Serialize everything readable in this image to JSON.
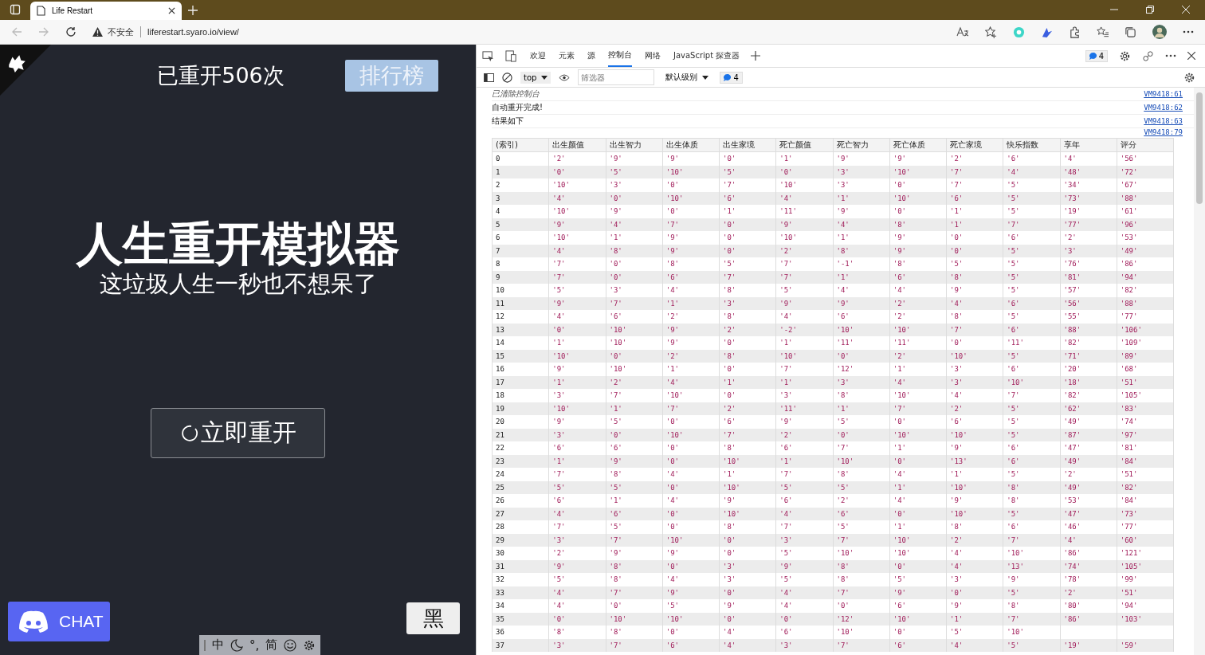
{
  "browser": {
    "tab_title": "Life Restart",
    "security": "不安全",
    "url": "liferestart.syaro.io/view/"
  },
  "page": {
    "restart_count": "已重开506次",
    "ranking_button": "排行榜",
    "title": "人生重开模拟器",
    "subtitle": "这垃圾人生一秒也不想呆了",
    "restart_button": "立即重开",
    "chat_button": "CHAT",
    "theme_button": "黑"
  },
  "ime_bar": [
    "中",
    "°,",
    "简"
  ],
  "devtools": {
    "tabs": [
      {
        "label": "欢迎",
        "selected": false
      },
      {
        "label": "元素",
        "selected": false
      },
      {
        "label": "源",
        "selected": false
      },
      {
        "label": "控制台",
        "selected": true
      },
      {
        "label": "网络",
        "selected": false
      },
      {
        "label": "JavaScript 探查器",
        "selected": false
      }
    ],
    "issues_count": "4",
    "context": "top",
    "filter_placeholder": "筛选器",
    "level": "默认级别",
    "message_count": "4",
    "messages": [
      {
        "text": "已清除控制台",
        "kind": "info",
        "source": "VM9418:61"
      },
      {
        "text": "自动重开完成!",
        "kind": "log",
        "source": "VM9418:62"
      },
      {
        "text": "结果如下",
        "kind": "log",
        "source": "VM9418:63"
      },
      {
        "kind": "table",
        "source": "VM9418:79"
      }
    ]
  },
  "table": {
    "columns": [
      "(索引)",
      "出生颜值",
      "出生智力",
      "出生体质",
      "出生家境",
      "死亡颜值",
      "死亡智力",
      "死亡体质",
      "死亡家境",
      "快乐指数",
      "享年",
      "评分"
    ],
    "rows": [
      [
        "0",
        "'2'",
        "'9'",
        "'9'",
        "'0'",
        "'1'",
        "'9'",
        "'9'",
        "'2'",
        "'6'",
        "'4'",
        "'56'"
      ],
      [
        "1",
        "'0'",
        "'5'",
        "'10'",
        "'5'",
        "'0'",
        "'3'",
        "'10'",
        "'7'",
        "'4'",
        "'48'",
        "'72'"
      ],
      [
        "2",
        "'10'",
        "'3'",
        "'0'",
        "'7'",
        "'10'",
        "'3'",
        "'0'",
        "'7'",
        "'5'",
        "'34'",
        "'67'"
      ],
      [
        "3",
        "'4'",
        "'0'",
        "'10'",
        "'6'",
        "'4'",
        "'1'",
        "'10'",
        "'6'",
        "'5'",
        "'73'",
        "'88'"
      ],
      [
        "4",
        "'10'",
        "'9'",
        "'0'",
        "'1'",
        "'11'",
        "'9'",
        "'0'",
        "'1'",
        "'5'",
        "'19'",
        "'61'"
      ],
      [
        "5",
        "'9'",
        "'4'",
        "'7'",
        "'0'",
        "'9'",
        "'4'",
        "'8'",
        "'1'",
        "'7'",
        "'77'",
        "'96'"
      ],
      [
        "6",
        "'10'",
        "'1'",
        "'9'",
        "'0'",
        "'10'",
        "'1'",
        "'9'",
        "'0'",
        "'6'",
        "'2'",
        "'53'"
      ],
      [
        "7",
        "'4'",
        "'8'",
        "'9'",
        "'0'",
        "'2'",
        "'8'",
        "'9'",
        "'0'",
        "'5'",
        "'3'",
        "'49'"
      ],
      [
        "8",
        "'7'",
        "'0'",
        "'8'",
        "'5'",
        "'7'",
        "'-1'",
        "'8'",
        "'5'",
        "'5'",
        "'76'",
        "'86'"
      ],
      [
        "9",
        "'7'",
        "'0'",
        "'6'",
        "'7'",
        "'7'",
        "'1'",
        "'6'",
        "'8'",
        "'5'",
        "'81'",
        "'94'"
      ],
      [
        "10",
        "'5'",
        "'3'",
        "'4'",
        "'8'",
        "'5'",
        "'4'",
        "'4'",
        "'9'",
        "'5'",
        "'57'",
        "'82'"
      ],
      [
        "11",
        "'9'",
        "'7'",
        "'1'",
        "'3'",
        "'9'",
        "'9'",
        "'2'",
        "'4'",
        "'6'",
        "'56'",
        "'88'"
      ],
      [
        "12",
        "'4'",
        "'6'",
        "'2'",
        "'8'",
        "'4'",
        "'6'",
        "'2'",
        "'8'",
        "'5'",
        "'55'",
        "'77'"
      ],
      [
        "13",
        "'0'",
        "'10'",
        "'9'",
        "'2'",
        "'-2'",
        "'10'",
        "'10'",
        "'7'",
        "'6'",
        "'88'",
        "'106'"
      ],
      [
        "14",
        "'1'",
        "'10'",
        "'9'",
        "'0'",
        "'1'",
        "'11'",
        "'11'",
        "'0'",
        "'11'",
        "'82'",
        "'109'"
      ],
      [
        "15",
        "'10'",
        "'0'",
        "'2'",
        "'8'",
        "'10'",
        "'0'",
        "'2'",
        "'10'",
        "'5'",
        "'71'",
        "'89'"
      ],
      [
        "16",
        "'9'",
        "'10'",
        "'1'",
        "'0'",
        "'7'",
        "'12'",
        "'1'",
        "'3'",
        "'6'",
        "'20'",
        "'68'"
      ],
      [
        "17",
        "'1'",
        "'2'",
        "'4'",
        "'1'",
        "'1'",
        "'3'",
        "'4'",
        "'3'",
        "'10'",
        "'18'",
        "'51'"
      ],
      [
        "18",
        "'3'",
        "'7'",
        "'10'",
        "'0'",
        "'3'",
        "'8'",
        "'10'",
        "'4'",
        "'7'",
        "'82'",
        "'105'"
      ],
      [
        "19",
        "'10'",
        "'1'",
        "'7'",
        "'2'",
        "'11'",
        "'1'",
        "'7'",
        "'2'",
        "'5'",
        "'62'",
        "'83'"
      ],
      [
        "20",
        "'9'",
        "'5'",
        "'0'",
        "'6'",
        "'9'",
        "'5'",
        "'0'",
        "'6'",
        "'5'",
        "'49'",
        "'74'"
      ],
      [
        "21",
        "'3'",
        "'0'",
        "'10'",
        "'7'",
        "'2'",
        "'0'",
        "'10'",
        "'10'",
        "'5'",
        "'87'",
        "'97'"
      ],
      [
        "22",
        "'6'",
        "'6'",
        "'0'",
        "'8'",
        "'6'",
        "'7'",
        "'1'",
        "'9'",
        "'6'",
        "'47'",
        "'81'"
      ],
      [
        "23",
        "'1'",
        "'9'",
        "'0'",
        "'10'",
        "'1'",
        "'10'",
        "'0'",
        "'13'",
        "'6'",
        "'49'",
        "'84'"
      ],
      [
        "24",
        "'7'",
        "'8'",
        "'4'",
        "'1'",
        "'7'",
        "'8'",
        "'4'",
        "'1'",
        "'5'",
        "'2'",
        "'51'"
      ],
      [
        "25",
        "'5'",
        "'5'",
        "'0'",
        "'10'",
        "'5'",
        "'5'",
        "'1'",
        "'10'",
        "'8'",
        "'49'",
        "'82'"
      ],
      [
        "26",
        "'6'",
        "'1'",
        "'4'",
        "'9'",
        "'6'",
        "'2'",
        "'4'",
        "'9'",
        "'8'",
        "'53'",
        "'84'"
      ],
      [
        "27",
        "'4'",
        "'6'",
        "'0'",
        "'10'",
        "'4'",
        "'6'",
        "'0'",
        "'10'",
        "'5'",
        "'47'",
        "'73'"
      ],
      [
        "28",
        "'7'",
        "'5'",
        "'0'",
        "'8'",
        "'7'",
        "'5'",
        "'1'",
        "'8'",
        "'6'",
        "'46'",
        "'77'"
      ],
      [
        "29",
        "'3'",
        "'7'",
        "'10'",
        "'0'",
        "'3'",
        "'7'",
        "'10'",
        "'2'",
        "'7'",
        "'4'",
        "'60'"
      ],
      [
        "30",
        "'2'",
        "'9'",
        "'9'",
        "'0'",
        "'5'",
        "'10'",
        "'10'",
        "'4'",
        "'10'",
        "'86'",
        "'121'"
      ],
      [
        "31",
        "'9'",
        "'8'",
        "'0'",
        "'3'",
        "'9'",
        "'8'",
        "'0'",
        "'4'",
        "'13'",
        "'74'",
        "'105'"
      ],
      [
        "32",
        "'5'",
        "'8'",
        "'4'",
        "'3'",
        "'5'",
        "'8'",
        "'5'",
        "'3'",
        "'9'",
        "'78'",
        "'99'"
      ],
      [
        "33",
        "'4'",
        "'7'",
        "'9'",
        "'0'",
        "'4'",
        "'7'",
        "'9'",
        "'0'",
        "'5'",
        "'2'",
        "'51'"
      ],
      [
        "34",
        "'4'",
        "'0'",
        "'5'",
        "'9'",
        "'4'",
        "'0'",
        "'6'",
        "'9'",
        "'8'",
        "'80'",
        "'94'"
      ],
      [
        "35",
        "'0'",
        "'10'",
        "'10'",
        "'0'",
        "'0'",
        "'12'",
        "'10'",
        "'1'",
        "'7'",
        "'86'",
        "'103'"
      ],
      [
        "36",
        "'8'",
        "'8'",
        "'0'",
        "'4'",
        "'6'",
        "'10'",
        "'0'",
        "'5'",
        "'10'"
      ],
      [
        "37",
        "'3'",
        "'7'",
        "'6'",
        "'4'",
        "'3'",
        "'7'",
        "'6'",
        "'4'",
        "'5'",
        "'19'",
        "'59'"
      ]
    ]
  }
}
